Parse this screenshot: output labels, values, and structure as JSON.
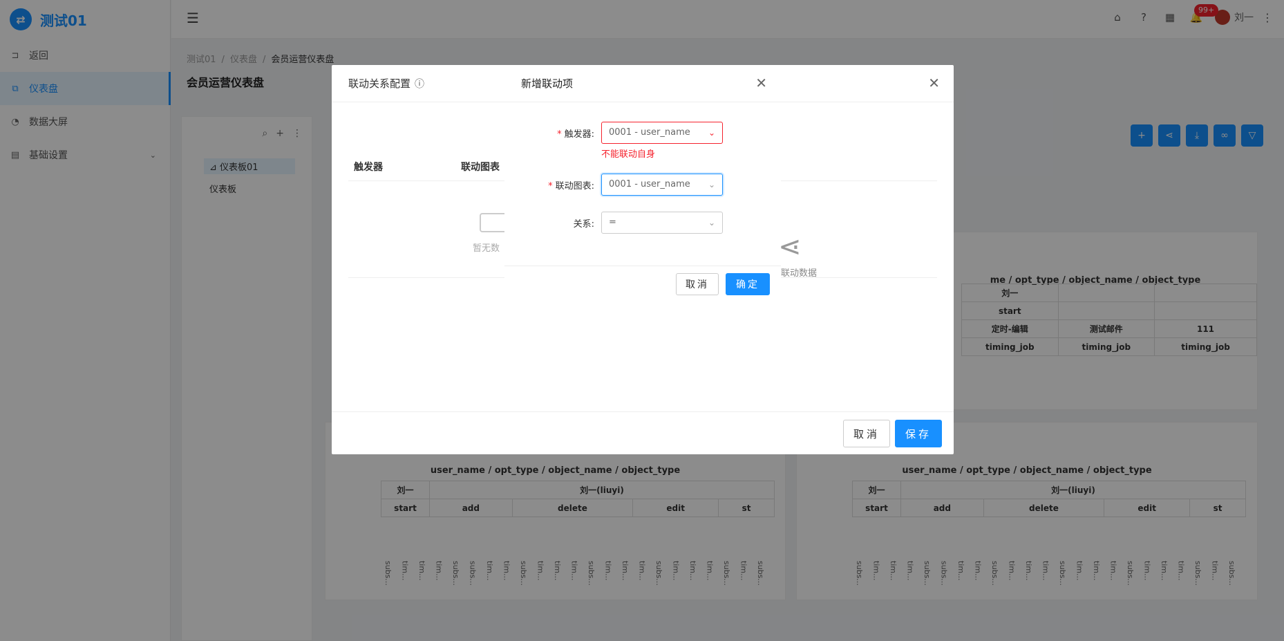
{
  "app": {
    "logo_glyph": "⇄",
    "title": "测试01"
  },
  "sidebar": {
    "items": [
      {
        "label": "返回",
        "icon": "back-icon"
      },
      {
        "label": "仪表盘",
        "icon": "dashboard-icon",
        "active": true
      },
      {
        "label": "数据大屏",
        "icon": "pie-chart-icon"
      },
      {
        "label": "基础设置",
        "icon": "settings-icon"
      }
    ]
  },
  "header": {
    "notification_badge": "99+",
    "user_name": "刘一"
  },
  "breadcrumb": [
    "测试01",
    "仪表盘",
    "会员运营仪表盘"
  ],
  "page_title": "会员运营仪表盘",
  "tree": {
    "nodes": [
      "仪表板01",
      "仪表板"
    ]
  },
  "cards": {
    "right_top_title": "me / opt_type / object_name / object_type",
    "right_top_rows": [
      [
        "刘一"
      ],
      [
        "start"
      ],
      [
        "定时-编辑",
        "测试邮件",
        "111"
      ],
      [
        "timing_job",
        "timing_job",
        "timing_job"
      ]
    ],
    "bottom_title": "user_name / opt_type / object_name / object_type",
    "pivot_header_1": [
      "刘一",
      "刘一(liuyi)"
    ],
    "pivot_header_2": [
      "start",
      "add",
      "delete",
      "edit",
      "st"
    ],
    "vertical_labels": [
      "subs...",
      "tim...",
      "tim...",
      "tim...",
      "subs...",
      "subs...",
      "tim...",
      "tim...",
      "subs...",
      "tim...",
      "tim...",
      "tim...",
      "subs...",
      "tim...",
      "tim...",
      "tim...",
      "subs...",
      "tim...",
      "tim...",
      "tim...",
      "subs...",
      "tim...",
      "subs..."
    ]
  },
  "linkage_modal": {
    "title": "联动关系配置",
    "columns": [
      "触发器",
      "联动图表"
    ],
    "empty_text": "暂无数",
    "right_text": "联动数据",
    "cancel": "取消",
    "save": "保存"
  },
  "add_modal": {
    "title": "新增联动项",
    "trigger_label": "触发器:",
    "trigger_value": "0001 - user_name",
    "trigger_error": "不能联动自身",
    "chart_label": "联动图表:",
    "chart_value": "0001 - user_name",
    "relation_label": "关系:",
    "relation_value": "=",
    "cancel": "取消",
    "ok": "确定"
  }
}
